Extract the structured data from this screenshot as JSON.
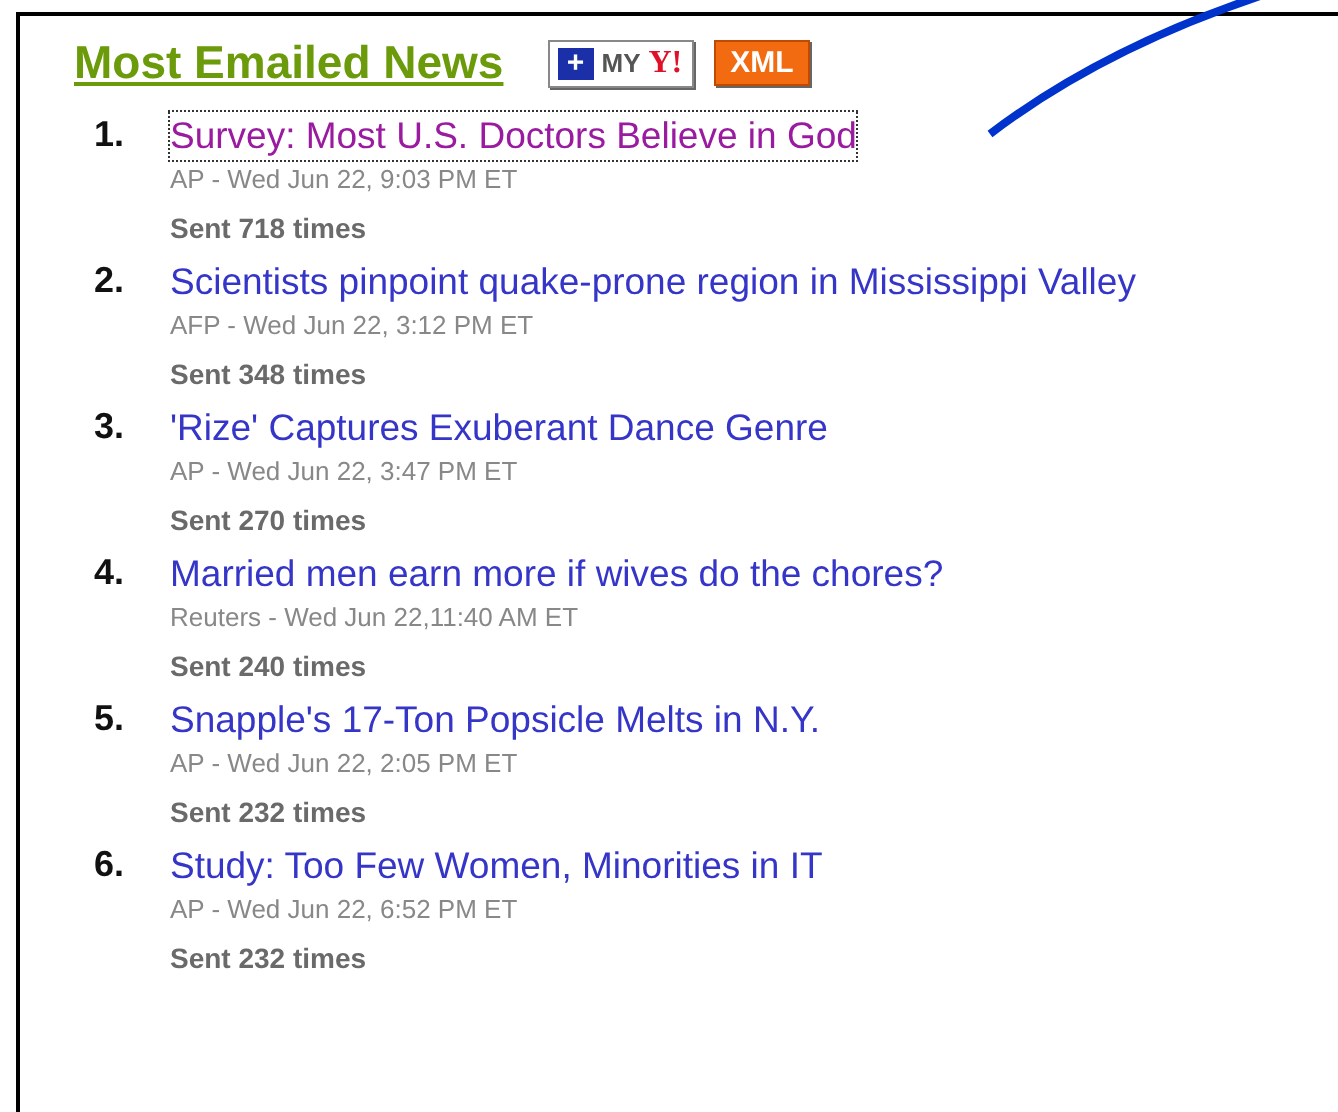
{
  "title": "Most Emailed News",
  "badges": [
    {
      "kind": "myyahoo",
      "plus": "+",
      "label": "MY",
      "brand": "Y!"
    },
    {
      "kind": "xml",
      "label": "XML"
    }
  ],
  "items": [
    {
      "number": "1.",
      "headline": "Survey: Most U.S. Doctors Believe in God",
      "meta": "AP - Wed Jun 22, 9:03 PM ET",
      "sent": "Sent 718 times",
      "visited": true,
      "focused": true
    },
    {
      "number": "2.",
      "headline": "Scientists pinpoint quake-prone region in Mississippi Valley",
      "meta": "AFP - Wed Jun 22, 3:12 PM ET",
      "sent": "Sent 348 times",
      "visited": false,
      "focused": false
    },
    {
      "number": "3.",
      "headline": "'Rize' Captures Exuberant Dance Genre",
      "meta": "AP - Wed Jun 22, 3:47 PM ET",
      "sent": "Sent 270 times",
      "visited": false,
      "focused": false
    },
    {
      "number": "4.",
      "headline": "Married men earn more if wives do the chores?",
      "meta": "Reuters - Wed Jun 22,11:40 AM ET",
      "sent": "Sent 240 times",
      "visited": false,
      "focused": false
    },
    {
      "number": "5.",
      "headline": "Snapple's 17-Ton Popsicle Melts in N.Y.",
      "meta": "AP - Wed Jun 22, 2:05 PM ET",
      "sent": "Sent 232 times",
      "visited": false,
      "focused": false
    },
    {
      "number": "6.",
      "headline": "Study: Too Few Women, Minorities in IT",
      "meta": "AP - Wed Jun 22, 6:52 PM ET",
      "sent": "Sent 232 times",
      "visited": false,
      "focused": false
    }
  ]
}
